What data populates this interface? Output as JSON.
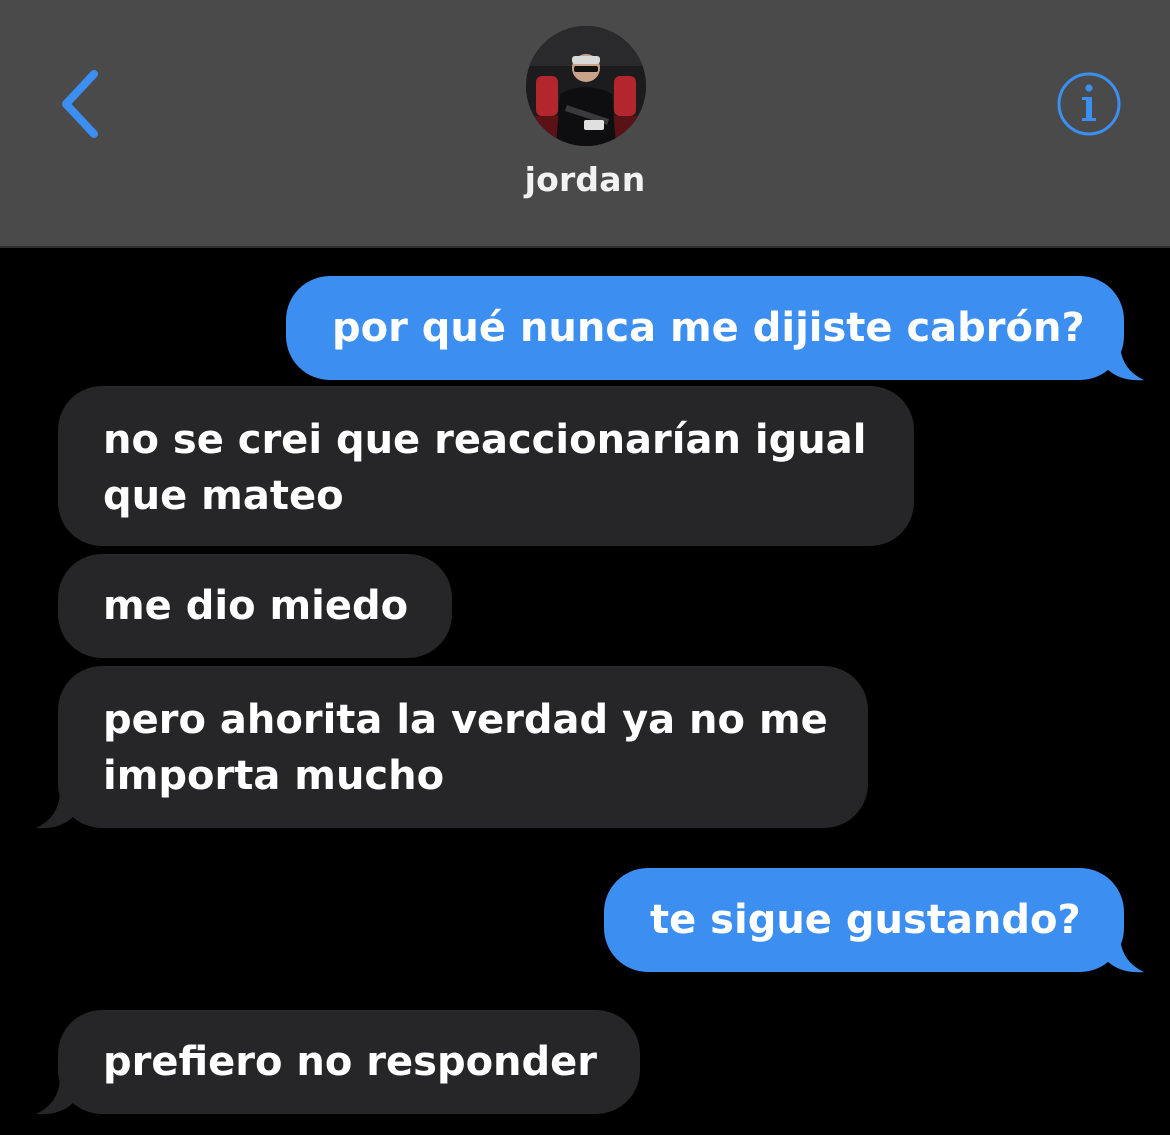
{
  "header": {
    "contact_name": "jordan",
    "back_icon": "chevron-left-icon",
    "info_icon": "info-circle-icon",
    "accent_color": "#3c8ff0",
    "background_color": "#4a4a4a"
  },
  "messages": [
    {
      "direction": "sent",
      "text": "por qué nunca me dijiste cabrón?"
    },
    {
      "direction": "received",
      "text": "no se crei que reaccionarían igual\nque mateo"
    },
    {
      "direction": "received",
      "text": "me dio miedo"
    },
    {
      "direction": "received",
      "text": "pero ahorita la verdad ya no me\nimporta mucho"
    },
    {
      "direction": "sent",
      "text": "te sigue gustando?"
    },
    {
      "direction": "received",
      "text": "prefiero no responder"
    }
  ],
  "colors": {
    "sent_bubble": "#3c8ff0",
    "received_bubble": "#262628",
    "thread_background": "#000000"
  }
}
